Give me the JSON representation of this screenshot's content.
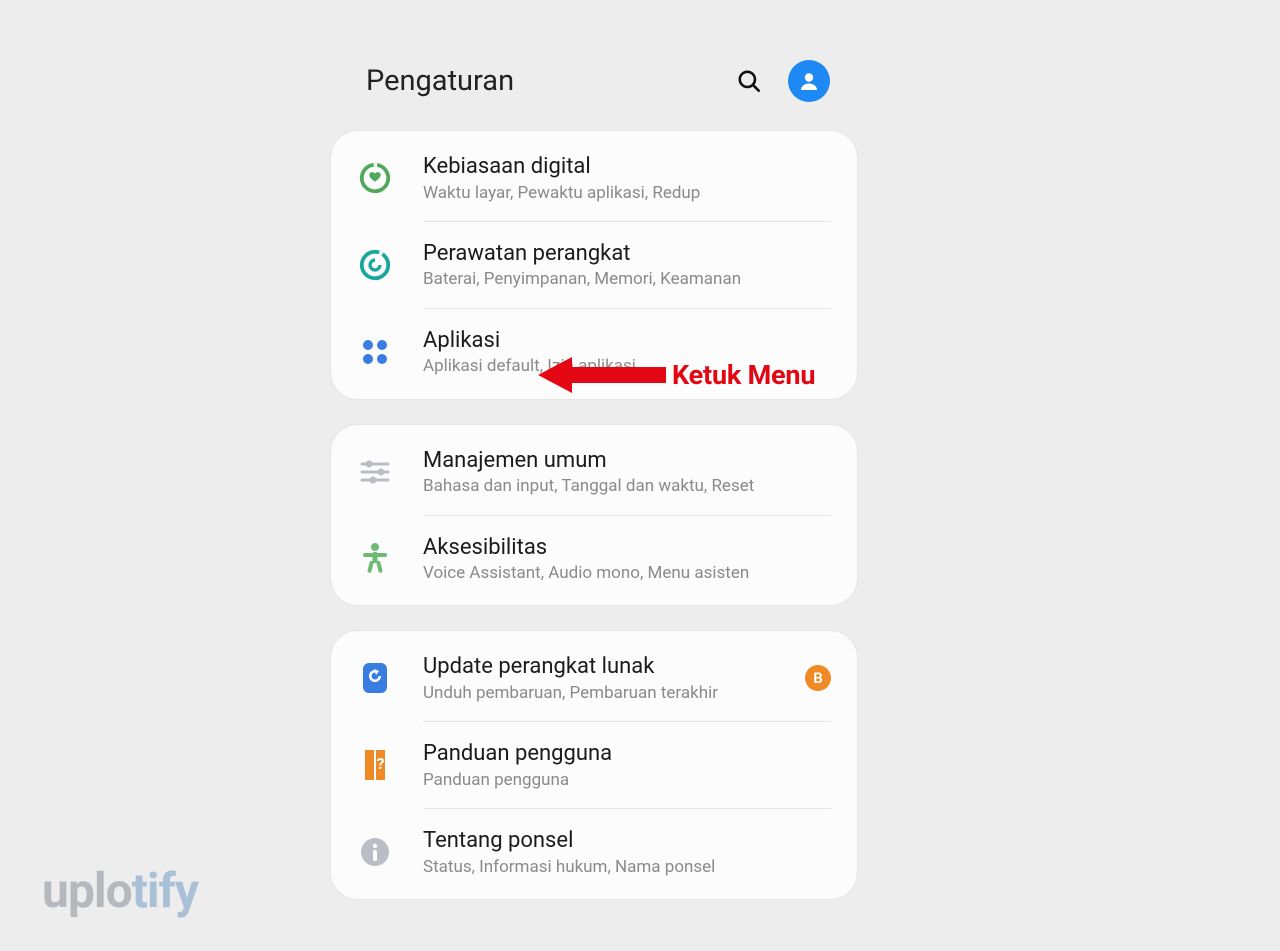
{
  "header": {
    "title": "Pengaturan"
  },
  "groups": [
    {
      "items": [
        {
          "icon": "heart",
          "title": "Kebiasaan digital",
          "subtitle": "Waktu layar, Pewaktu aplikasi, Redup"
        },
        {
          "icon": "care",
          "title": "Perawatan perangkat",
          "subtitle": "Baterai, Penyimpanan, Memori, Keamanan"
        },
        {
          "icon": "apps",
          "title": "Aplikasi",
          "subtitle": "Aplikasi default, Izin aplikasi"
        }
      ]
    },
    {
      "items": [
        {
          "icon": "sliders",
          "title": "Manajemen umum",
          "subtitle": "Bahasa dan input, Tanggal dan waktu, Reset"
        },
        {
          "icon": "accessibility",
          "title": "Aksesibilitas",
          "subtitle": "Voice Assistant, Audio mono, Menu asisten"
        }
      ]
    },
    {
      "items": [
        {
          "icon": "update",
          "title": "Update perangkat lunak",
          "subtitle": "Unduh pembaruan, Pembaruan terakhir",
          "badge": "B"
        },
        {
          "icon": "guide",
          "title": "Panduan pengguna",
          "subtitle": "Panduan pengguna"
        },
        {
          "icon": "info",
          "title": "Tentang ponsel",
          "subtitle": "Status, Informasi hukum, Nama ponsel"
        }
      ]
    }
  ],
  "annotation": {
    "label": "Ketuk Menu"
  },
  "watermark": {
    "part1": "uplo",
    "part2": "tify"
  }
}
